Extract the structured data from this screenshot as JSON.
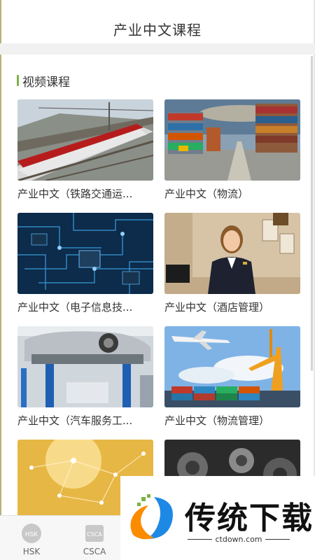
{
  "header": {
    "title": "产业中文课程"
  },
  "section": {
    "title": "视频课程"
  },
  "courses": [
    {
      "label": "产业中文（铁路交通运..."
    },
    {
      "label": "产业中文（物流）"
    },
    {
      "label": "产业中文（电子信息技..."
    },
    {
      "label": "产业中文（酒店管理）"
    },
    {
      "label": "产业中文（汽车服务工..."
    },
    {
      "label": "产业中文（物流管理）"
    },
    {
      "label": ""
    },
    {
      "label": ""
    }
  ],
  "tabbar": {
    "tabs": [
      {
        "label": "HSK",
        "icon": "hsk-icon",
        "icon_text": "HSK"
      },
      {
        "label": "CSCA",
        "icon": "csca-icon",
        "icon_text": "CSCA"
      }
    ]
  },
  "watermark": {
    "title": "传统下载",
    "url": "ctdown.com"
  },
  "colors": {
    "accent": "#7cb342",
    "watermark_blue": "#1e88e5",
    "watermark_orange": "#fb8c00"
  }
}
